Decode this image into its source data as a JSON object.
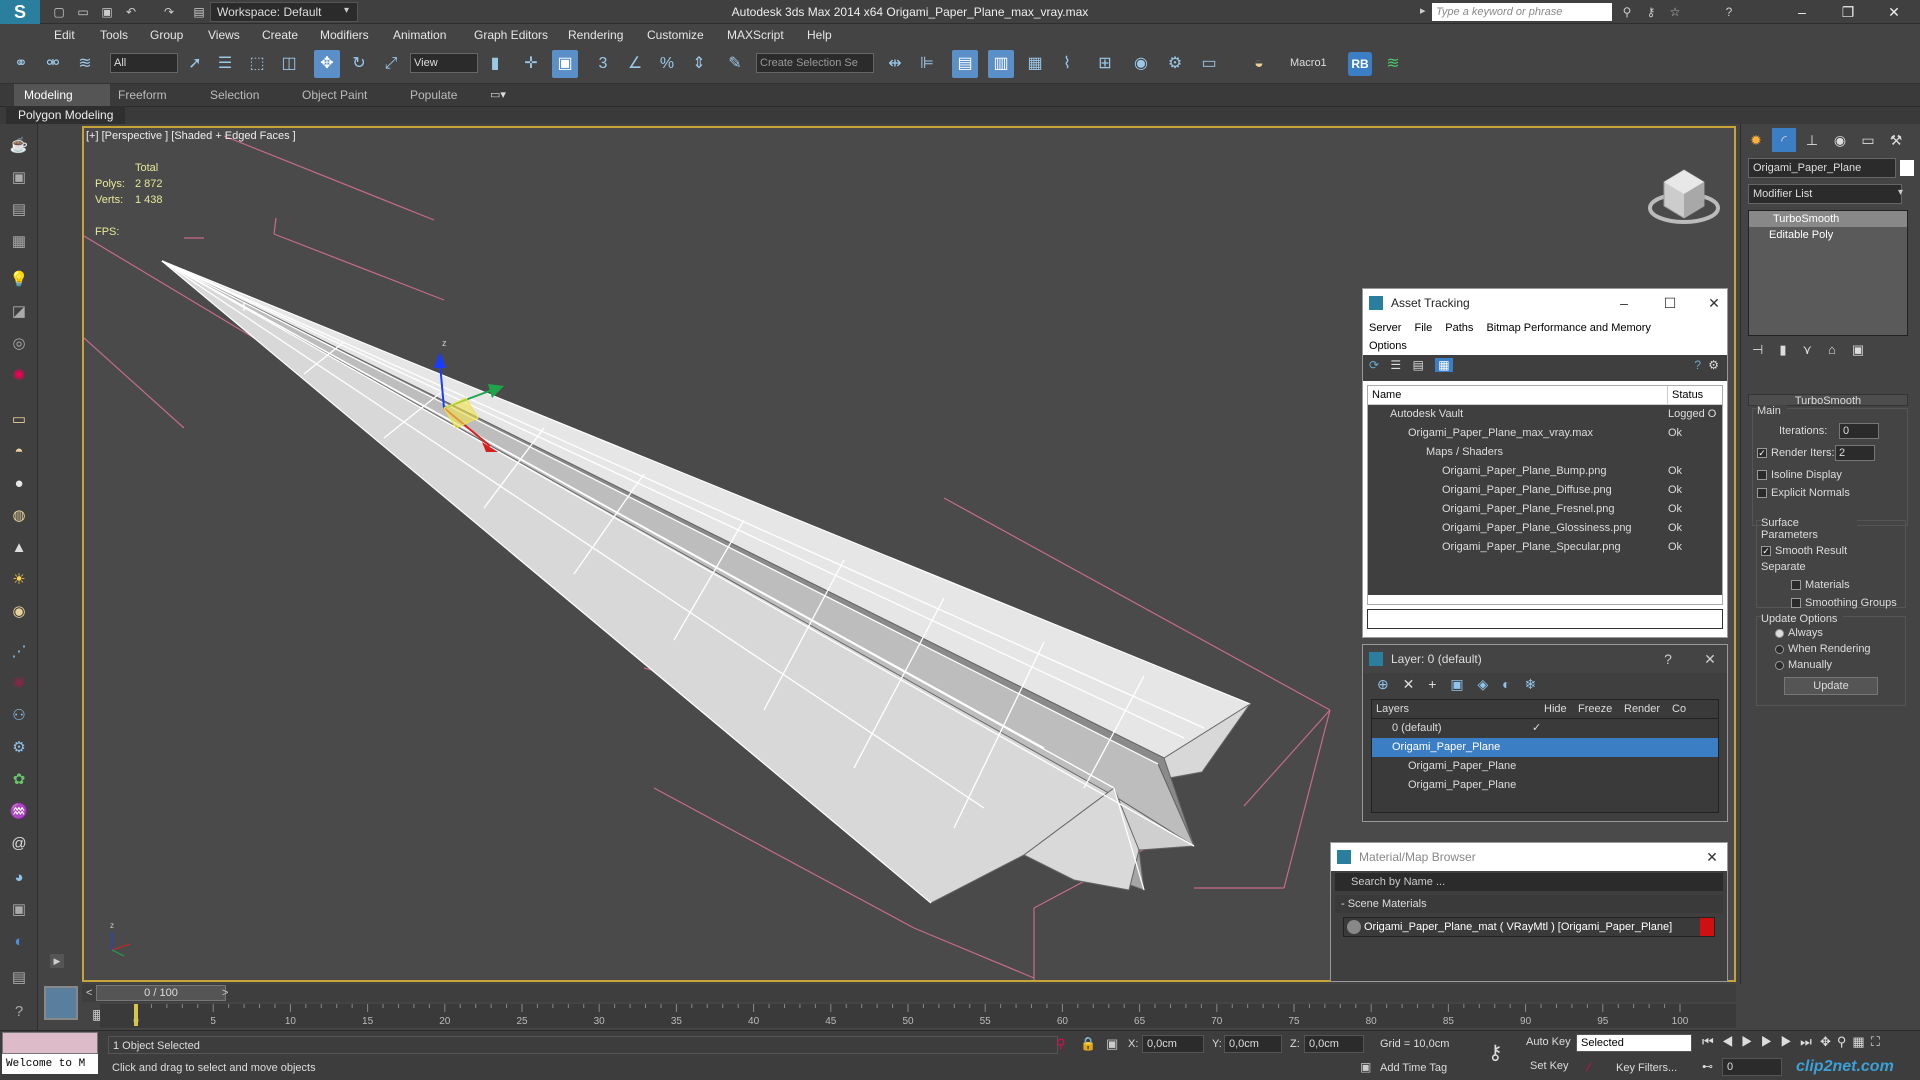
{
  "app": {
    "title": "Autodesk 3ds Max  2014 x64    Origami_Paper_Plane_max_vray.max",
    "workspace": "Workspace: Default",
    "search_placeholder": "Type a keyword or phrase",
    "minimize": "–",
    "maximize": "❐",
    "close": "✕"
  },
  "menu": [
    "Edit",
    "Tools",
    "Group",
    "Views",
    "Create",
    "Modifiers",
    "Animation",
    "Graph Editors",
    "Rendering",
    "Customize",
    "MAXScript",
    "Help"
  ],
  "toolbar": {
    "selection_filter": "All",
    "ref_coord": "View",
    "selection_set_placeholder": "Create Selection Se",
    "macro_label": "Macro1",
    "rb_label": "RB"
  },
  "ribbon": {
    "tabs": [
      "Modeling",
      "Freeform",
      "Selection",
      "Object Paint",
      "Populate"
    ],
    "active_tab": "Modeling",
    "subpanel": "Polygon Modeling"
  },
  "viewport": {
    "label": "[+] [Perspective ] [Shaded + Edged Faces ]",
    "stats_header": "Total",
    "polys_label": "Polys:",
    "polys_value": "2 872",
    "verts_label": "Verts:",
    "verts_value": "1 438",
    "fps_label": "FPS:"
  },
  "command_panel": {
    "object_name": "Origami_Paper_Plane",
    "modifier_list": "Modifier List",
    "stack": [
      "TurboSmooth",
      "Editable Poly"
    ],
    "rollout_title": "TurboSmooth",
    "main_label": "Main",
    "iterations_label": "Iterations:",
    "iterations_value": "0",
    "render_iters_label": "Render Iters:",
    "render_iters_value": "2",
    "isoline_label": "Isoline Display",
    "explicit_normals_label": "Explicit Normals",
    "surface_params_label": "Surface Parameters",
    "smooth_result_label": "Smooth Result",
    "separate_label": "Separate",
    "materials_label": "Materials",
    "smoothing_groups_label": "Smoothing Groups",
    "update_options_label": "Update Options",
    "always_label": "Always",
    "when_rendering_label": "When Rendering",
    "manually_label": "Manually",
    "update_button": "Update"
  },
  "asset_tracking": {
    "title": "Asset Tracking",
    "menu": [
      "Server",
      "File",
      "Paths",
      "Bitmap Performance and Memory"
    ],
    "menu2": "Options",
    "col_name": "Name",
    "col_status": "Status",
    "rows": [
      {
        "name": "Autodesk Vault",
        "status": "Logged O"
      },
      {
        "name": "Origami_Paper_Plane_max_vray.max",
        "status": "Ok"
      },
      {
        "name": "Maps / Shaders",
        "status": ""
      },
      {
        "name": "Origami_Paper_Plane_Bump.png",
        "status": "Ok"
      },
      {
        "name": "Origami_Paper_Plane_Diffuse.png",
        "status": "Ok"
      },
      {
        "name": "Origami_Paper_Plane_Fresnel.png",
        "status": "Ok"
      },
      {
        "name": "Origami_Paper_Plane_Glossiness.png",
        "status": "Ok"
      },
      {
        "name": "Origami_Paper_Plane_Specular.png",
        "status": "Ok"
      }
    ]
  },
  "layer_dialog": {
    "title": "Layer: 0 (default)",
    "help": "?",
    "col_layers": "Layers",
    "col_hide": "Hide",
    "col_freeze": "Freeze",
    "col_render": "Render",
    "col_color": "Co",
    "rows": [
      {
        "name": "0 (default)"
      },
      {
        "name": "Origami_Paper_Plane"
      },
      {
        "name": "Origami_Paper_Plane"
      },
      {
        "name": "Origami_Paper_Plane"
      }
    ]
  },
  "material_browser": {
    "title": "Material/Map Browser",
    "search_placeholder": "Search by Name ...",
    "section": "- Scene Materials",
    "material": "Origami_Paper_Plane_mat  ( VRayMtl )  [Origami_Paper_Plane]"
  },
  "timeline": {
    "frame": "0 / 100",
    "ticks": [
      "0",
      "5",
      "10",
      "15",
      "20",
      "25",
      "30",
      "35",
      "40",
      "45",
      "50",
      "55",
      "60",
      "65",
      "70",
      "75",
      "80",
      "85",
      "90",
      "95",
      "100"
    ]
  },
  "status": {
    "maxscript": "Welcome to M",
    "selected": "1 Object Selected",
    "prompt": "Click and drag to select and move objects",
    "x_label": "X:",
    "x_value": "0,0cm",
    "y_label": "Y:",
    "y_value": "0,0cm",
    "z_label": "Z:",
    "z_value": "0,0cm",
    "grid": "Grid = 10,0cm",
    "add_time_tag": "Add Time Tag",
    "auto_key": "Auto Key",
    "set_key": "Set Key",
    "key_mode": "Selected",
    "key_filters": "Key Filters...",
    "frame_field": "0",
    "watermark": "clip2net.com"
  }
}
